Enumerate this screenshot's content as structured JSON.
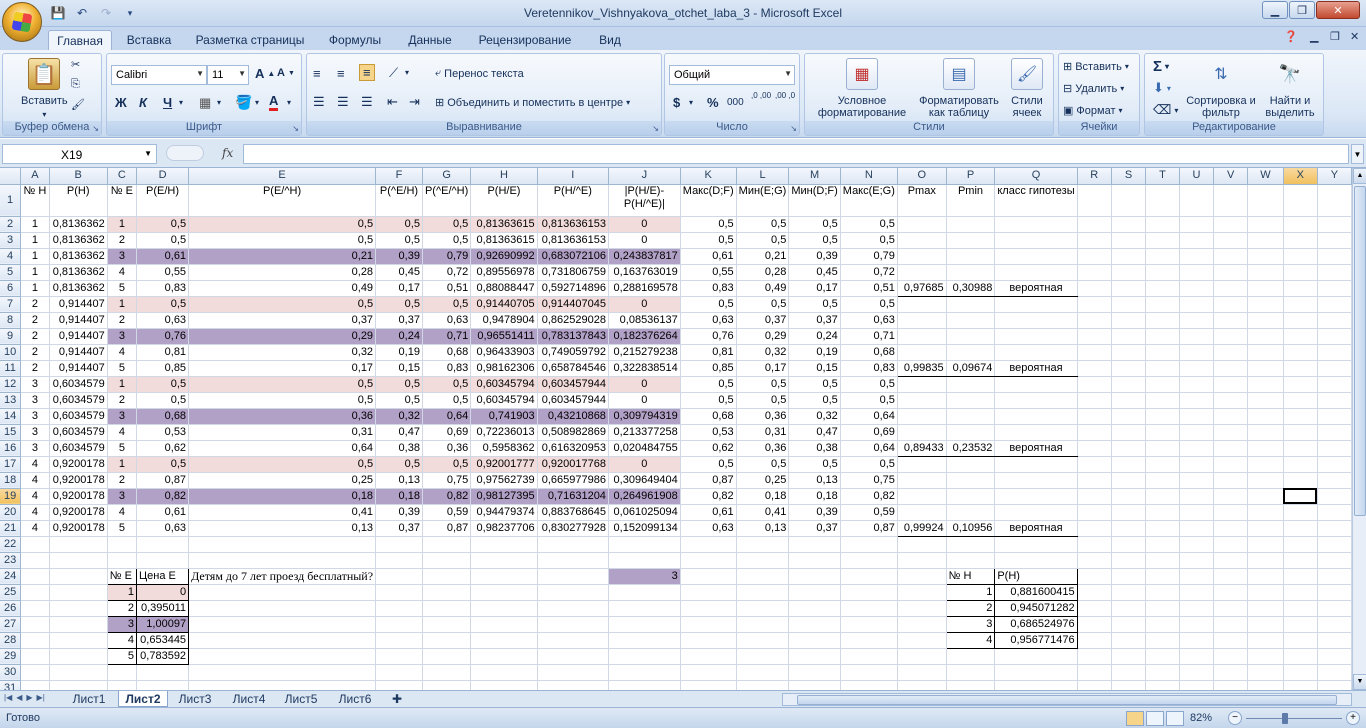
{
  "window": {
    "title": "Veretennikov_Vishnyakova_otchet_laba_3 - Microsoft Excel"
  },
  "ribbon_tabs": [
    "Главная",
    "Вставка",
    "Разметка страницы",
    "Формулы",
    "Данные",
    "Рецензирование",
    "Вид"
  ],
  "ribbon": {
    "clipboard": {
      "label": "Буфер обмена",
      "paste": "Вставить"
    },
    "font": {
      "label": "Шрифт",
      "name": "Calibri",
      "size": "11",
      "bold": "Ж",
      "italic": "К",
      "underline": "Ч"
    },
    "alignment": {
      "label": "Выравнивание",
      "wrap": "Перенос текста",
      "merge": "Объединить и поместить в центре"
    },
    "number": {
      "label": "Число",
      "format": "Общий",
      "currency": "$",
      "percent": "%",
      "thousands": "000",
      "inc_decimal": ",0 ,00",
      "dec_decimal": ",00 ,0"
    },
    "styles": {
      "label": "Стили",
      "conditional": "Условное форматирование",
      "as_table": "Форматировать как таблицу",
      "cell_styles": "Стили ячеек"
    },
    "cells": {
      "label": "Ячейки",
      "insert": "Вставить",
      "delete": "Удалить",
      "format": "Формат"
    },
    "editing": {
      "label": "Редактирование",
      "sort": "Сортировка и фильтр",
      "find": "Найти и выделить"
    }
  },
  "formula_bar": {
    "name_box": "X19",
    "formula": "",
    "fx": "fx"
  },
  "columns": [
    "A",
    "B",
    "C",
    "D",
    "E",
    "F",
    "G",
    "H",
    "I",
    "J",
    "K",
    "L",
    "M",
    "N",
    "O",
    "P",
    "Q",
    "R",
    "S",
    "T",
    "U",
    "V",
    "W",
    "X",
    "Y"
  ],
  "header_row": [
    "№ H",
    "P(H)",
    "№ E",
    "P(E/H)",
    "P(E/^H)",
    "P(^E/H)",
    "P(^E/^H)",
    "P(H/E)",
    "P(H/^E)",
    "|P(H/E)-P(H/^E)|",
    "Макс(D;F)",
    "Мин(E;G)",
    "Мин(D;F)",
    "Макс(E;G)",
    "Pmax",
    "Pmin",
    "класс гипотезы"
  ],
  "rows": [
    [
      "1",
      "0,8136362",
      "1",
      "0,5",
      "0,5",
      "0,5",
      "0,5",
      "0,81363615",
      "0,813636153",
      "0",
      "0,5",
      "0,5",
      "0,5",
      "0,5",
      "",
      "",
      ""
    ],
    [
      "1",
      "0,8136362",
      "2",
      "0,5",
      "0,5",
      "0,5",
      "0,5",
      "0,81363615",
      "0,813636153",
      "0",
      "0,5",
      "0,5",
      "0,5",
      "0,5",
      "",
      "",
      ""
    ],
    [
      "1",
      "0,8136362",
      "3",
      "0,61",
      "0,21",
      "0,39",
      "0,79",
      "0,92690992",
      "0,683072106",
      "0,243837817",
      "0,61",
      "0,21",
      "0,39",
      "0,79",
      "",
      "",
      ""
    ],
    [
      "1",
      "0,8136362",
      "4",
      "0,55",
      "0,28",
      "0,45",
      "0,72",
      "0,89556978",
      "0,731806759",
      "0,163763019",
      "0,55",
      "0,28",
      "0,45",
      "0,72",
      "",
      "",
      ""
    ],
    [
      "1",
      "0,8136362",
      "5",
      "0,83",
      "0,49",
      "0,17",
      "0,51",
      "0,88088447",
      "0,592714896",
      "0,288169578",
      "0,83",
      "0,49",
      "0,17",
      "0,51",
      "0,97685",
      "0,30988",
      "вероятная"
    ],
    [
      "2",
      "0,914407",
      "1",
      "0,5",
      "0,5",
      "0,5",
      "0,5",
      "0,91440705",
      "0,914407045",
      "0",
      "0,5",
      "0,5",
      "0,5",
      "0,5",
      "",
      "",
      ""
    ],
    [
      "2",
      "0,914407",
      "2",
      "0,63",
      "0,37",
      "0,37",
      "0,63",
      "0,9478904",
      "0,862529028",
      "0,08536137",
      "0,63",
      "0,37",
      "0,37",
      "0,63",
      "",
      "",
      ""
    ],
    [
      "2",
      "0,914407",
      "3",
      "0,76",
      "0,29",
      "0,24",
      "0,71",
      "0,96551411",
      "0,783137843",
      "0,182376264",
      "0,76",
      "0,29",
      "0,24",
      "0,71",
      "",
      "",
      ""
    ],
    [
      "2",
      "0,914407",
      "4",
      "0,81",
      "0,32",
      "0,19",
      "0,68",
      "0,96433903",
      "0,749059792",
      "0,215279238",
      "0,81",
      "0,32",
      "0,19",
      "0,68",
      "",
      "",
      ""
    ],
    [
      "2",
      "0,914407",
      "5",
      "0,85",
      "0,17",
      "0,15",
      "0,83",
      "0,98162306",
      "0,658784546",
      "0,322838514",
      "0,85",
      "0,17",
      "0,15",
      "0,83",
      "0,99835",
      "0,09674",
      "вероятная"
    ],
    [
      "3",
      "0,6034579",
      "1",
      "0,5",
      "0,5",
      "0,5",
      "0,5",
      "0,60345794",
      "0,603457944",
      "0",
      "0,5",
      "0,5",
      "0,5",
      "0,5",
      "",
      "",
      ""
    ],
    [
      "3",
      "0,6034579",
      "2",
      "0,5",
      "0,5",
      "0,5",
      "0,5",
      "0,60345794",
      "0,603457944",
      "0",
      "0,5",
      "0,5",
      "0,5",
      "0,5",
      "",
      "",
      ""
    ],
    [
      "3",
      "0,6034579",
      "3",
      "0,68",
      "0,36",
      "0,32",
      "0,64",
      "0,741903",
      "0,43210868",
      "0,309794319",
      "0,68",
      "0,36",
      "0,32",
      "0,64",
      "",
      "",
      ""
    ],
    [
      "3",
      "0,6034579",
      "4",
      "0,53",
      "0,31",
      "0,47",
      "0,69",
      "0,72236013",
      "0,508982869",
      "0,213377258",
      "0,53",
      "0,31",
      "0,47",
      "0,69",
      "",
      "",
      ""
    ],
    [
      "3",
      "0,6034579",
      "5",
      "0,62",
      "0,64",
      "0,38",
      "0,36",
      "0,5958362",
      "0,616320953",
      "0,020484755",
      "0,62",
      "0,36",
      "0,38",
      "0,64",
      "0,89433",
      "0,23532",
      "вероятная"
    ],
    [
      "4",
      "0,9200178",
      "1",
      "0,5",
      "0,5",
      "0,5",
      "0,5",
      "0,92001777",
      "0,920017768",
      "0",
      "0,5",
      "0,5",
      "0,5",
      "0,5",
      "",
      "",
      ""
    ],
    [
      "4",
      "0,9200178",
      "2",
      "0,87",
      "0,25",
      "0,13",
      "0,75",
      "0,97562739",
      "0,665977986",
      "0,309649404",
      "0,87",
      "0,25",
      "0,13",
      "0,75",
      "",
      "",
      ""
    ],
    [
      "4",
      "0,9200178",
      "3",
      "0,82",
      "0,18",
      "0,18",
      "0,82",
      "0,98127395",
      "0,71631204",
      "0,264961908",
      "0,82",
      "0,18",
      "0,18",
      "0,82",
      "",
      "",
      ""
    ],
    [
      "4",
      "0,9200178",
      "4",
      "0,61",
      "0,41",
      "0,39",
      "0,59",
      "0,94479374",
      "0,883768645",
      "0,061025094",
      "0,61",
      "0,41",
      "0,39",
      "0,59",
      "",
      "",
      ""
    ],
    [
      "4",
      "0,9200178",
      "5",
      "0,63",
      "0,13",
      "0,37",
      "0,87",
      "0,98237706",
      "0,830277928",
      "0,152099134",
      "0,63",
      "0,13",
      "0,37",
      "0,87",
      "0,99924",
      "0,10956",
      "вероятная"
    ]
  ],
  "price_table": {
    "header": [
      "№ E",
      "Цена E"
    ],
    "rows": [
      [
        "1",
        "0"
      ],
      [
        "2",
        "0,395011"
      ],
      [
        "3",
        "1,00097"
      ],
      [
        "4",
        "0,653445"
      ],
      [
        "5",
        "0,783592"
      ]
    ]
  },
  "question": {
    "text": "Детям до 7 лет проезд бесплатный?",
    "answer": "3"
  },
  "ph_table": {
    "header": [
      "№ H",
      "P(H)"
    ],
    "rows": [
      [
        "1",
        "0,881600415"
      ],
      [
        "2",
        "0,945071282"
      ],
      [
        "3",
        "0,686524976"
      ],
      [
        "4",
        "0,956771476"
      ]
    ]
  },
  "sheet_tabs": [
    "Лист1",
    "Лист2",
    "Лист3",
    "Лист4",
    "Лист5",
    "Лист6"
  ],
  "active_sheet": "Лист2",
  "status": {
    "text": "Готово",
    "zoom": "82%"
  },
  "colors": {
    "pink": "#f2dcdb",
    "purple": "#b2a1c7",
    "grid": "#d0d7e5"
  }
}
